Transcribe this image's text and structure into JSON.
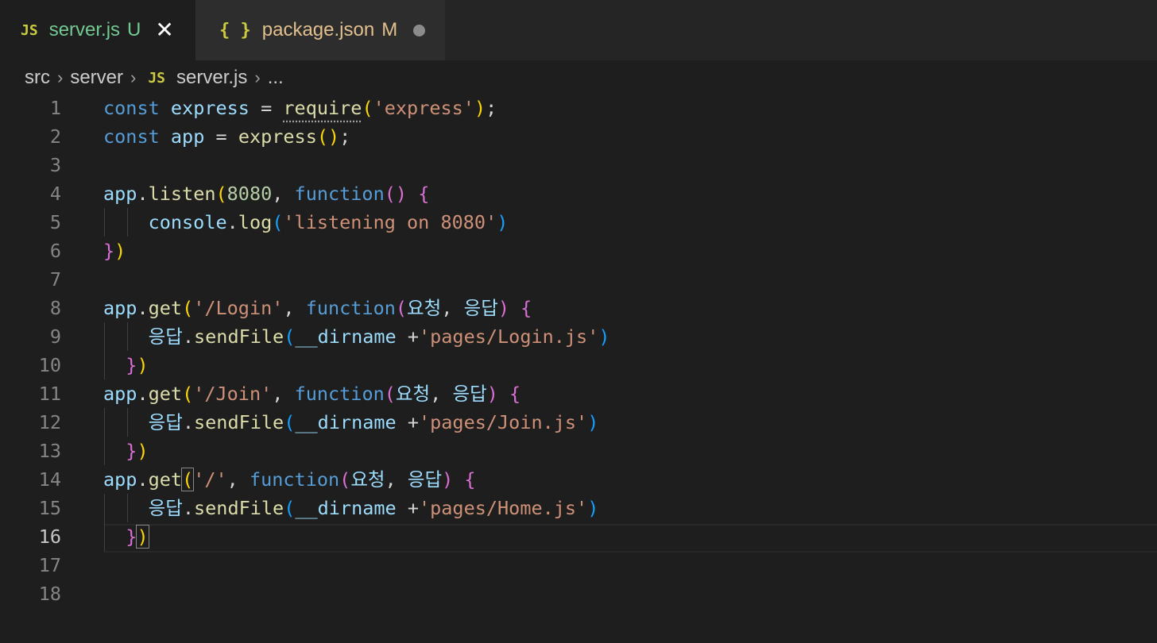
{
  "tabs": [
    {
      "icon": "JS",
      "name": "server.js",
      "status": "U",
      "active": true
    },
    {
      "icon": "{ }",
      "name": "package.json",
      "status": "M",
      "active": false
    }
  ],
  "breadcrumb": [
    "src",
    "server",
    "server.js",
    "..."
  ],
  "breadcrumb_file_icon": "JS",
  "editor": {
    "current_line": 16,
    "lines": [
      {
        "n": "1",
        "tokens": [
          [
            "kw",
            "const"
          ],
          [
            "txt",
            " "
          ],
          [
            "var",
            "express"
          ],
          [
            "txt",
            " = "
          ],
          [
            "fn",
            "require"
          ],
          [
            "p1",
            "("
          ],
          [
            "str",
            "'express'"
          ],
          [
            "p1",
            ")"
          ],
          [
            "txt",
            ";"
          ]
        ]
      },
      {
        "n": "2",
        "tokens": [
          [
            "kw",
            "const"
          ],
          [
            "txt",
            " "
          ],
          [
            "var",
            "app"
          ],
          [
            "txt",
            " = "
          ],
          [
            "fn",
            "express"
          ],
          [
            "p1",
            "()"
          ],
          [
            "txt",
            ";"
          ]
        ]
      },
      {
        "n": "3",
        "tokens": []
      },
      {
        "n": "4",
        "tokens": [
          [
            "var",
            "app"
          ],
          [
            "txt",
            "."
          ],
          [
            "fn",
            "listen"
          ],
          [
            "p1",
            "("
          ],
          [
            "num",
            "8080"
          ],
          [
            "txt",
            ", "
          ],
          [
            "kw",
            "function"
          ],
          [
            "p2",
            "()"
          ],
          [
            "txt",
            " "
          ],
          [
            "p2",
            "{"
          ]
        ]
      },
      {
        "n": "5",
        "tokens": [
          [
            "txt",
            "    "
          ],
          [
            "var",
            "console"
          ],
          [
            "txt",
            "."
          ],
          [
            "fn",
            "log"
          ],
          [
            "p3",
            "("
          ],
          [
            "str",
            "'listening on 8080'"
          ],
          [
            "p3",
            ")"
          ]
        ]
      },
      {
        "n": "6",
        "tokens": [
          [
            "p2",
            "}"
          ],
          [
            "p1",
            ")"
          ]
        ]
      },
      {
        "n": "7",
        "tokens": []
      },
      {
        "n": "8",
        "tokens": [
          [
            "var",
            "app"
          ],
          [
            "txt",
            "."
          ],
          [
            "fn",
            "get"
          ],
          [
            "p1",
            "("
          ],
          [
            "str",
            "'/Login'"
          ],
          [
            "txt",
            ", "
          ],
          [
            "kw",
            "function"
          ],
          [
            "p2",
            "("
          ],
          [
            "par",
            "요청"
          ],
          [
            "txt",
            ", "
          ],
          [
            "par",
            "응답"
          ],
          [
            "p2",
            ")"
          ],
          [
            "txt",
            " "
          ],
          [
            "p2",
            "{"
          ]
        ]
      },
      {
        "n": "9",
        "tokens": [
          [
            "txt",
            "    "
          ],
          [
            "var",
            "응답"
          ],
          [
            "txt",
            "."
          ],
          [
            "fn",
            "sendFile"
          ],
          [
            "p3",
            "("
          ],
          [
            "var",
            "__dirname"
          ],
          [
            "txt",
            " +"
          ],
          [
            "str",
            "'pages/Login.js'"
          ],
          [
            "p3",
            ")"
          ]
        ]
      },
      {
        "n": "10",
        "tokens": [
          [
            "txt",
            "  "
          ],
          [
            "p2",
            "}"
          ],
          [
            "p1",
            ")"
          ]
        ]
      },
      {
        "n": "11",
        "tokens": [
          [
            "var",
            "app"
          ],
          [
            "txt",
            "."
          ],
          [
            "fn",
            "get"
          ],
          [
            "p1",
            "("
          ],
          [
            "str",
            "'/Join'"
          ],
          [
            "txt",
            ", "
          ],
          [
            "kw",
            "function"
          ],
          [
            "p2",
            "("
          ],
          [
            "par",
            "요청"
          ],
          [
            "txt",
            ", "
          ],
          [
            "par",
            "응답"
          ],
          [
            "p2",
            ")"
          ],
          [
            "txt",
            " "
          ],
          [
            "p2",
            "{"
          ]
        ]
      },
      {
        "n": "12",
        "tokens": [
          [
            "txt",
            "    "
          ],
          [
            "var",
            "응답"
          ],
          [
            "txt",
            "."
          ],
          [
            "fn",
            "sendFile"
          ],
          [
            "p3",
            "("
          ],
          [
            "var",
            "__dirname"
          ],
          [
            "txt",
            " +"
          ],
          [
            "str",
            "'pages/Join.js'"
          ],
          [
            "p3",
            ")"
          ]
        ]
      },
      {
        "n": "13",
        "tokens": [
          [
            "txt",
            "  "
          ],
          [
            "p2",
            "}"
          ],
          [
            "p1",
            ")"
          ]
        ]
      },
      {
        "n": "14",
        "tokens": [
          [
            "var",
            "app"
          ],
          [
            "txt",
            "."
          ],
          [
            "fn",
            "get"
          ],
          [
            "p1",
            "("
          ],
          [
            "str",
            "'/'"
          ],
          [
            "txt",
            ", "
          ],
          [
            "kw",
            "function"
          ],
          [
            "p2",
            "("
          ],
          [
            "par",
            "요청"
          ],
          [
            "txt",
            ", "
          ],
          [
            "par",
            "응답"
          ],
          [
            "p2",
            ")"
          ],
          [
            "txt",
            " "
          ],
          [
            "p2",
            "{"
          ]
        ]
      },
      {
        "n": "15",
        "tokens": [
          [
            "txt",
            "    "
          ],
          [
            "var",
            "응답"
          ],
          [
            "txt",
            "."
          ],
          [
            "fn",
            "sendFile"
          ],
          [
            "p3",
            "("
          ],
          [
            "var",
            "__dirname"
          ],
          [
            "txt",
            " +"
          ],
          [
            "str",
            "'pages/Home.js'"
          ],
          [
            "p3",
            ")"
          ]
        ]
      },
      {
        "n": "16",
        "tokens": [
          [
            "txt",
            "  "
          ],
          [
            "p2",
            "}"
          ],
          [
            "p1",
            ")"
          ]
        ]
      },
      {
        "n": "17",
        "tokens": []
      },
      {
        "n": "18",
        "tokens": []
      }
    ]
  }
}
